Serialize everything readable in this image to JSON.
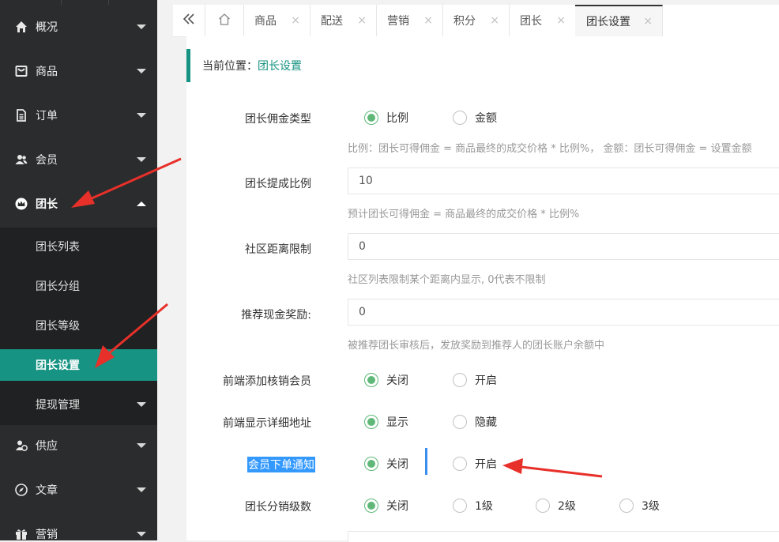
{
  "sidebar": {
    "menu": [
      {
        "label": "概况",
        "icon": "home-icon"
      },
      {
        "label": "商品",
        "icon": "goods-icon"
      },
      {
        "label": "订单",
        "icon": "order-icon"
      },
      {
        "label": "会员",
        "icon": "members-icon"
      },
      {
        "label": "团长",
        "icon": "crown-icon"
      },
      {
        "label": "供应",
        "icon": "supplier-icon"
      },
      {
        "label": "文章",
        "icon": "compass-icon"
      },
      {
        "label": "营销",
        "icon": "gift-icon"
      }
    ],
    "submenu": [
      {
        "label": "团长列表"
      },
      {
        "label": "团长分组"
      },
      {
        "label": "团长等级"
      },
      {
        "label": "团长设置"
      },
      {
        "label": "提现管理"
      }
    ]
  },
  "tabs": [
    {
      "label": "商品"
    },
    {
      "label": "配送"
    },
    {
      "label": "营销"
    },
    {
      "label": "积分"
    },
    {
      "label": "团长"
    },
    {
      "label": "团长设置"
    }
  ],
  "tab_close_glyph": "×",
  "breadcrumb": {
    "prefix": "当前位置：",
    "current": "团长设置"
  },
  "form": {
    "commission_type": {
      "label": "团长佣金类型",
      "options": [
        "比例",
        "金额"
      ],
      "selected": "比例",
      "hint": "比例：团长可得佣金 = 商品最终的成交价格 * 比例%， 金额：团长可得佣金 = 设置金额"
    },
    "commission_rate": {
      "label": "团长提成比例",
      "value": "10",
      "hint": "预计团长可得佣金 = 商品最终的成交价格 * 比例%"
    },
    "distance_limit": {
      "label": "社区距离限制",
      "value": "0",
      "hint": "社区列表限制某个距离内显示, 0代表不限制"
    },
    "referral_reward": {
      "label": "推荐现金奖励:",
      "value": "0",
      "hint": "被推荐团长审核后，发放奖励到推荐人的团长账户余额中"
    },
    "frontend_add_verifier": {
      "label": "前端添加核销会员",
      "options": [
        "关闭",
        "开启"
      ],
      "selected": "关闭"
    },
    "frontend_show_address": {
      "label": "前端显示详细地址",
      "options": [
        "显示",
        "隐藏"
      ],
      "selected": "显示"
    },
    "member_order_notify": {
      "label": "会员下单通知",
      "options": [
        "关闭",
        "开启"
      ],
      "selected": "关闭"
    },
    "distribution_levels": {
      "label": "团长分销级数",
      "options": [
        "关闭",
        "1级",
        "2级",
        "3级"
      ],
      "selected": "关闭"
    }
  },
  "colors": {
    "accent": "#169382",
    "sidebar_bg": "#2b2c2d",
    "radio_checked": "#5fb878",
    "annotation_arrow": "#e8302a"
  }
}
